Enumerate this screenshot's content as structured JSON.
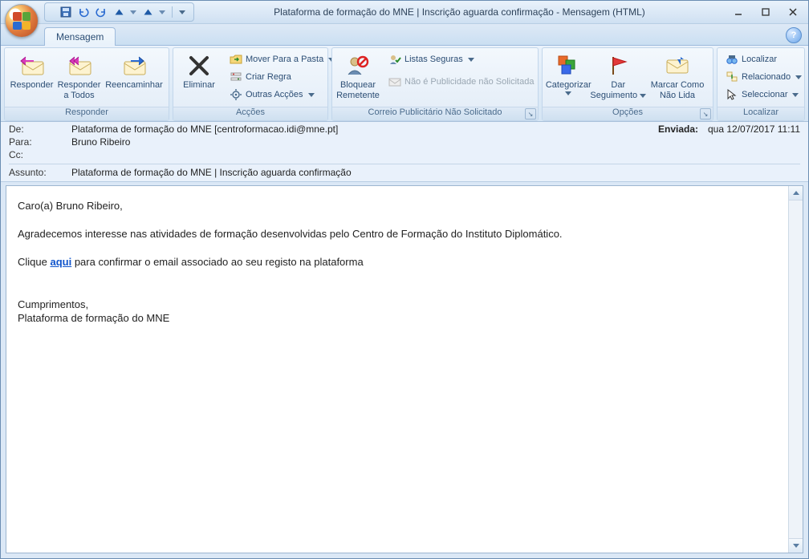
{
  "window": {
    "title": "Plataforma de formação do MNE | Inscrição aguarda confirmação - Mensagem (HTML)"
  },
  "qat": {
    "save": "Guardar",
    "undo": "Anular",
    "redo": "Refazer",
    "prev": "Anterior",
    "next": "Seguinte"
  },
  "tabs": {
    "message": "Mensagem"
  },
  "ribbon": {
    "responder": {
      "title": "Responder",
      "reply": "Responder",
      "reply_all_l1": "Responder",
      "reply_all_l2": "a Todos",
      "forward": "Reencaminhar"
    },
    "accoes": {
      "title": "Acções",
      "delete": "Eliminar",
      "move": "Mover Para a Pasta",
      "rule": "Criar Regra",
      "other": "Outras Acções"
    },
    "junk": {
      "title": "Correio Publicitário Não Solicitado",
      "block_l1": "Bloquear",
      "block_l2": "Remetente",
      "safe": "Listas Seguras",
      "notjunk": "Não é Publicidade não Solicitada"
    },
    "opcoes": {
      "title": "Opções",
      "categorize": "Categorizar",
      "follow_l1": "Dar",
      "follow_l2": "Seguimento",
      "unread_l1": "Marcar Como",
      "unread_l2": "Não Lida"
    },
    "localizar": {
      "title": "Localizar",
      "find": "Localizar",
      "related": "Relacionado",
      "select": "Seleccionar"
    }
  },
  "header": {
    "from_lbl": "De:",
    "from_val": "Plataforma de formação do MNE [centroformacao.idi@mne.pt]",
    "to_lbl": "Para:",
    "to_val": "Bruno Ribeiro",
    "cc_lbl": "Cc:",
    "cc_val": "",
    "subj_lbl": "Assunto:",
    "subj_val": "Plataforma de formação do MNE | Inscrição aguarda confirmação",
    "sent_lbl": "Enviada:",
    "sent_val": "qua 12/07/2017 11:11"
  },
  "body": {
    "greeting": "Caro(a) Bruno Ribeiro,",
    "p1": "Agradecemos interesse nas atividades de formação desenvolvidas pelo Centro de Formação do Instituto Diplomático.",
    "p2a": "Clique ",
    "link": "aqui",
    "p2b": " para confirmar o email associado ao seu registo na plataforma",
    "closing1": "Cumprimentos,",
    "closing2": "Plataforma de formação do MNE"
  }
}
